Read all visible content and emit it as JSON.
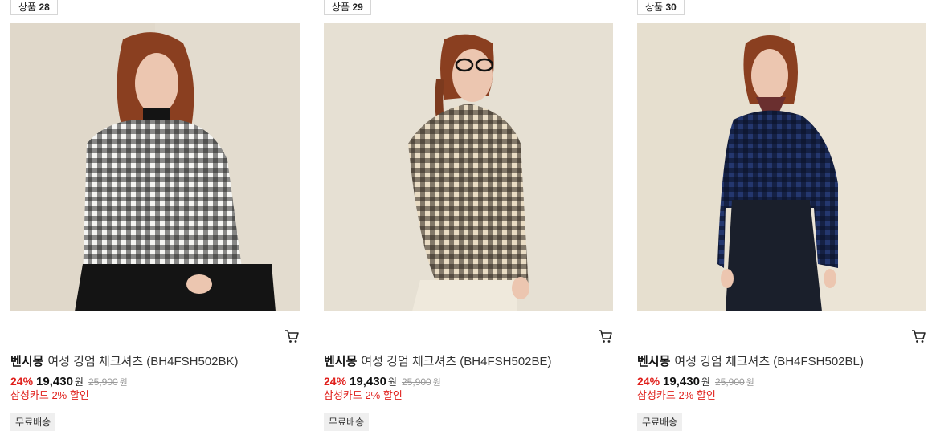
{
  "products": [
    {
      "badge_prefix": "상품",
      "badge_number": "28",
      "brand": "벤시몽",
      "name": "여성 깅엄 체크셔츠 (BH4FSH502BK)",
      "discount_rate": "24%",
      "price": "19,430",
      "currency": "원",
      "original_price": "25,900",
      "original_currency": "원",
      "card_discount": "삼성카드 2% 할인",
      "shipping_tag": "무료배송",
      "shirt_color": "#1b1b1b",
      "icon": "cart-icon"
    },
    {
      "badge_prefix": "상품",
      "badge_number": "29",
      "brand": "벤시몽",
      "name": "여성 깅엄 체크셔츠 (BH4FSH502BE)",
      "discount_rate": "24%",
      "price": "19,430",
      "currency": "원",
      "original_price": "25,900",
      "original_currency": "원",
      "card_discount": "삼성카드 2% 할인",
      "shipping_tag": "무료배송",
      "shirt_color": "#3a3026",
      "icon": "cart-icon"
    },
    {
      "badge_prefix": "상품",
      "badge_number": "30",
      "brand": "벤시몽",
      "name": "여성 깅엄 체크셔츠 (BH4FSH502BL)",
      "discount_rate": "24%",
      "price": "19,430",
      "currency": "원",
      "original_price": "25,900",
      "original_currency": "원",
      "card_discount": "삼성카드 2% 할인",
      "shipping_tag": "무료배송",
      "shirt_color": "#1e3c86",
      "icon": "cart-icon"
    }
  ]
}
